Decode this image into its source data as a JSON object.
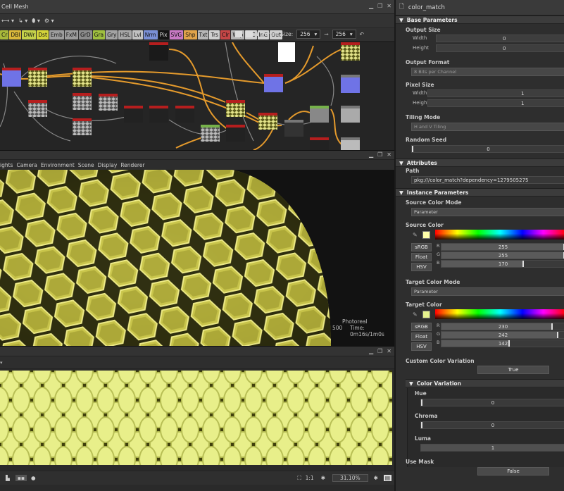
{
  "graph_panel": {
    "title": "Cell Mesh",
    "parent_size_label": "Parent Size:",
    "parent_size_value": "256",
    "second_size_value": "256",
    "node_buttons": [
      {
        "label": "Cr",
        "color": "#a8b83a"
      },
      {
        "label": "DBl",
        "color": "#d9b83a"
      },
      {
        "label": "DWr",
        "color": "#c5d24a"
      },
      {
        "label": "Dst",
        "color": "#d4d43a"
      },
      {
        "label": "Emb",
        "color": "#9d9d9d"
      },
      {
        "label": "FxM",
        "color": "#9c9c9c"
      },
      {
        "label": "GrD",
        "color": "#8c8c8c"
      },
      {
        "label": "Gra",
        "color": "#9fbf3f"
      },
      {
        "label": "Gry",
        "color": "#a3a3a3"
      },
      {
        "label": "HSL",
        "color": "#a8a8a8"
      },
      {
        "label": "Lvl",
        "color": "#c2c2c2"
      },
      {
        "label": "Nrm",
        "color": "#7a8fd6"
      },
      {
        "label": "Pix",
        "color": "#141414"
      },
      {
        "label": "SVG",
        "color": "#c879c4"
      },
      {
        "label": "Shp",
        "color": "#e0a34a"
      },
      {
        "label": "Txt",
        "color": "#b7b7b7"
      },
      {
        "label": "Trs",
        "color": "#cfcfcf"
      },
      {
        "label": "Clr",
        "color": "#c64646"
      },
      {
        "label": "Wrp",
        "color": "#b5b5b5"
      },
      {
        "label": "InC",
        "color": "#cfcfcf"
      },
      {
        "label": "InG",
        "color": "#d2d2d2"
      },
      {
        "label": "Out",
        "color": "#d0d0d0"
      }
    ]
  },
  "view3d": {
    "menu": [
      "ights",
      "Camera",
      "Environment",
      "Scene",
      "Display",
      "Renderer"
    ],
    "renderer": "Photoreal",
    "time": "Time: 0m16s/1m0s",
    "samples": "500"
  },
  "view2d": {
    "zoom": "31.10%",
    "ratio": "1:1"
  },
  "props": {
    "title": "color_match",
    "sections": {
      "base": "Base Parameters",
      "attributes": "Attributes",
      "instance": "Instance Parameters",
      "color_variation": "Color Variation"
    },
    "output_size": {
      "label": "Output Size",
      "width_label": "Width",
      "height_label": "Height",
      "width": "0",
      "height": "0"
    },
    "output_format": {
      "label": "Output Format",
      "value": "8 Bits per Channel"
    },
    "pixel_size": {
      "label": "Pixel Size",
      "width_label": "Width",
      "height_label": "Height",
      "width": "1",
      "height": "1"
    },
    "tiling_mode": {
      "label": "Tiling Mode",
      "value": "H and V Tiling"
    },
    "random_seed": {
      "label": "Random Seed",
      "value": "0"
    },
    "path": {
      "label": "Path",
      "value": "pkg:///color_match?dependency=1279505275"
    },
    "source_color_mode": {
      "label": "Source Color Mode",
      "value": "Parameter"
    },
    "source_color": {
      "label": "Source Color",
      "swatch": "#ffffaa",
      "srgb": "sRGB",
      "float": "Float",
      "hsv": "HSV",
      "r_label": "R",
      "g_label": "G",
      "b_label": "B",
      "r": "255",
      "g": "255",
      "b": "170",
      "r_frac": 1.0,
      "g_frac": 1.0,
      "b_frac": 0.667
    },
    "target_color_mode": {
      "label": "Target Color Mode",
      "value": "Parameter"
    },
    "target_color": {
      "label": "Target Color",
      "swatch": "#e6f28e",
      "srgb": "sRGB",
      "float": "Float",
      "hsv": "HSV",
      "r_label": "R",
      "g_label": "G",
      "b_label": "B",
      "r": "230",
      "g": "242",
      "b": "142",
      "r_frac": 0.902,
      "g_frac": 0.949,
      "b_frac": 0.557
    },
    "custom_color_variation": {
      "label": "Custom Color Variation",
      "value": "True"
    },
    "hue": {
      "label": "Hue",
      "value": "0"
    },
    "chroma": {
      "label": "Chroma",
      "value": "0"
    },
    "luma": {
      "label": "Luma",
      "value": "1"
    },
    "use_mask": {
      "label": "Use Mask",
      "value": "False"
    }
  }
}
